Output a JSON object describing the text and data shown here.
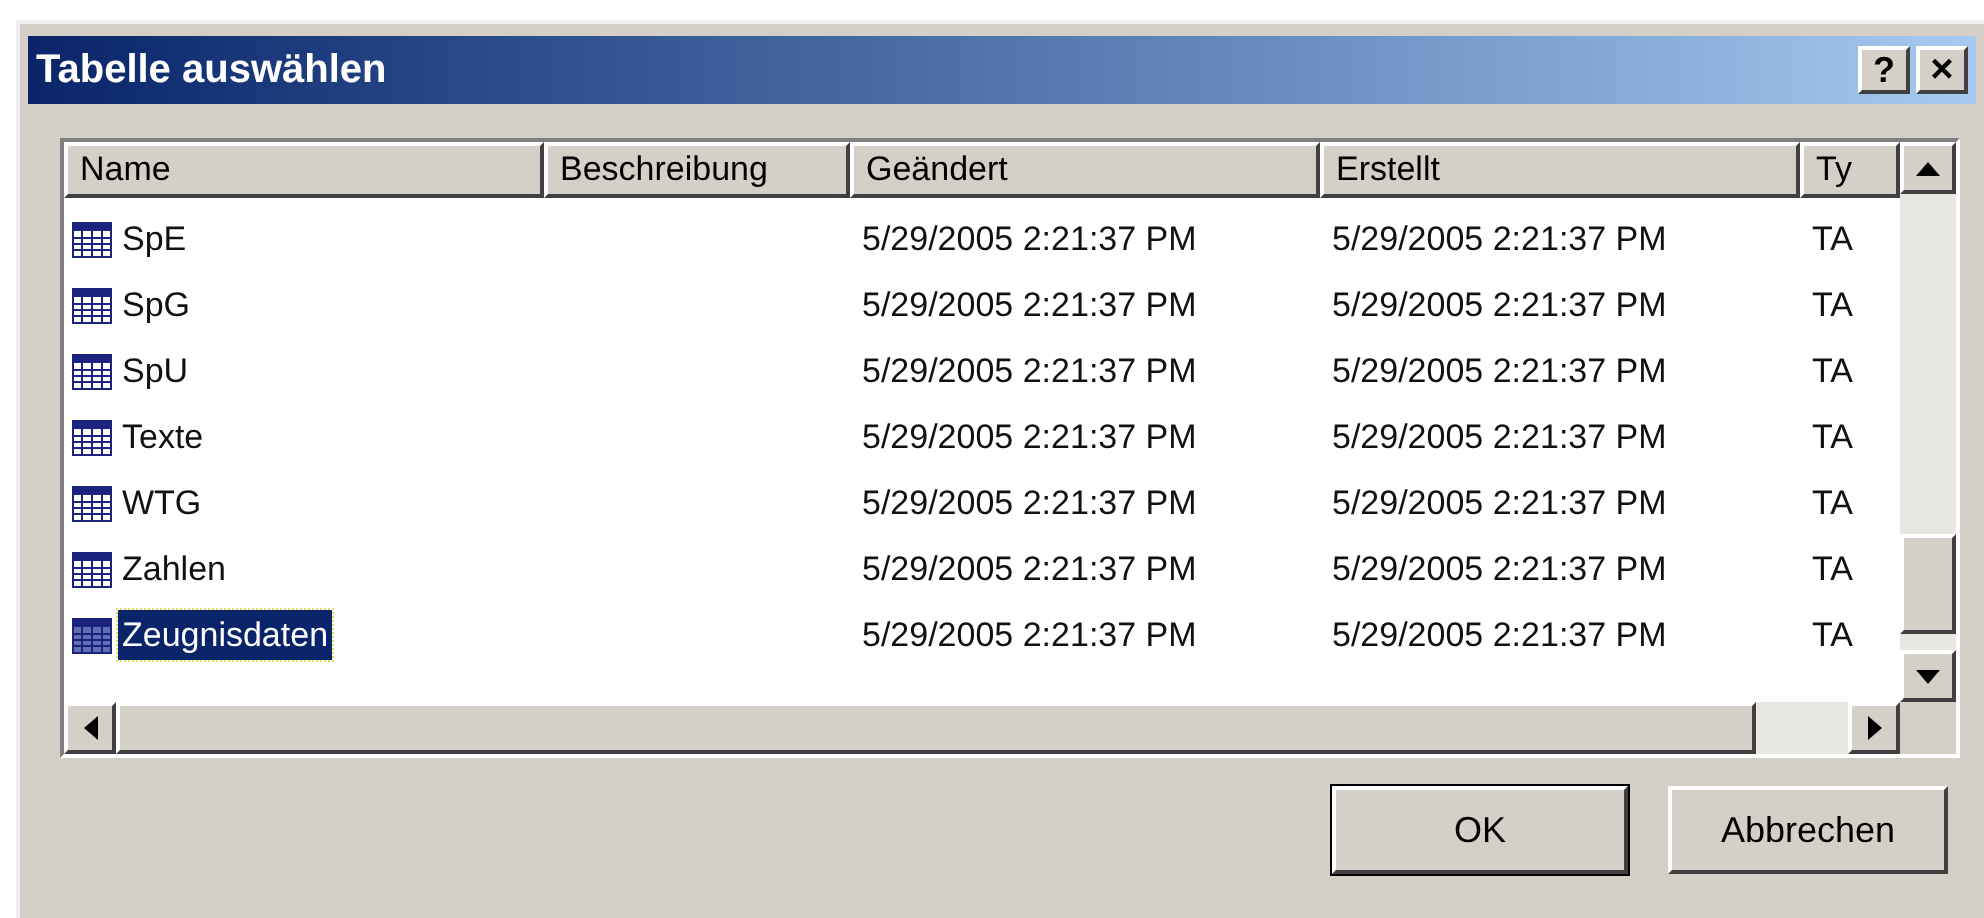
{
  "window": {
    "title": "Tabelle auswählen",
    "help_button": "?",
    "close_button": "×"
  },
  "table": {
    "columns": [
      "Name",
      "Beschreibung",
      "Geändert",
      "Erstellt",
      "Ty"
    ],
    "rows": [
      {
        "name": "SpE",
        "modified": "5/29/2005 2:21:37 PM",
        "created": "5/29/2005 2:21:37 PM",
        "type": "TA",
        "selected": false
      },
      {
        "name": "SpG",
        "modified": "5/29/2005 2:21:37 PM",
        "created": "5/29/2005 2:21:37 PM",
        "type": "TA",
        "selected": false
      },
      {
        "name": "SpU",
        "modified": "5/29/2005 2:21:37 PM",
        "created": "5/29/2005 2:21:37 PM",
        "type": "TA",
        "selected": false
      },
      {
        "name": "Texte",
        "modified": "5/29/2005 2:21:37 PM",
        "created": "5/29/2005 2:21:37 PM",
        "type": "TA",
        "selected": false
      },
      {
        "name": "WTG",
        "modified": "5/29/2005 2:21:37 PM",
        "created": "5/29/2005 2:21:37 PM",
        "type": "TA",
        "selected": false
      },
      {
        "name": "Zahlen",
        "modified": "5/29/2005 2:21:37 PM",
        "created": "5/29/2005 2:21:37 PM",
        "type": "TA",
        "selected": false
      },
      {
        "name": "Zeugnisdaten",
        "modified": "5/29/2005 2:21:37 PM",
        "created": "5/29/2005 2:21:37 PM",
        "type": "TA",
        "selected": true
      }
    ]
  },
  "buttons": [
    {
      "label": "OK",
      "default": true
    },
    {
      "label": "Abbrechen",
      "default": false
    }
  ]
}
